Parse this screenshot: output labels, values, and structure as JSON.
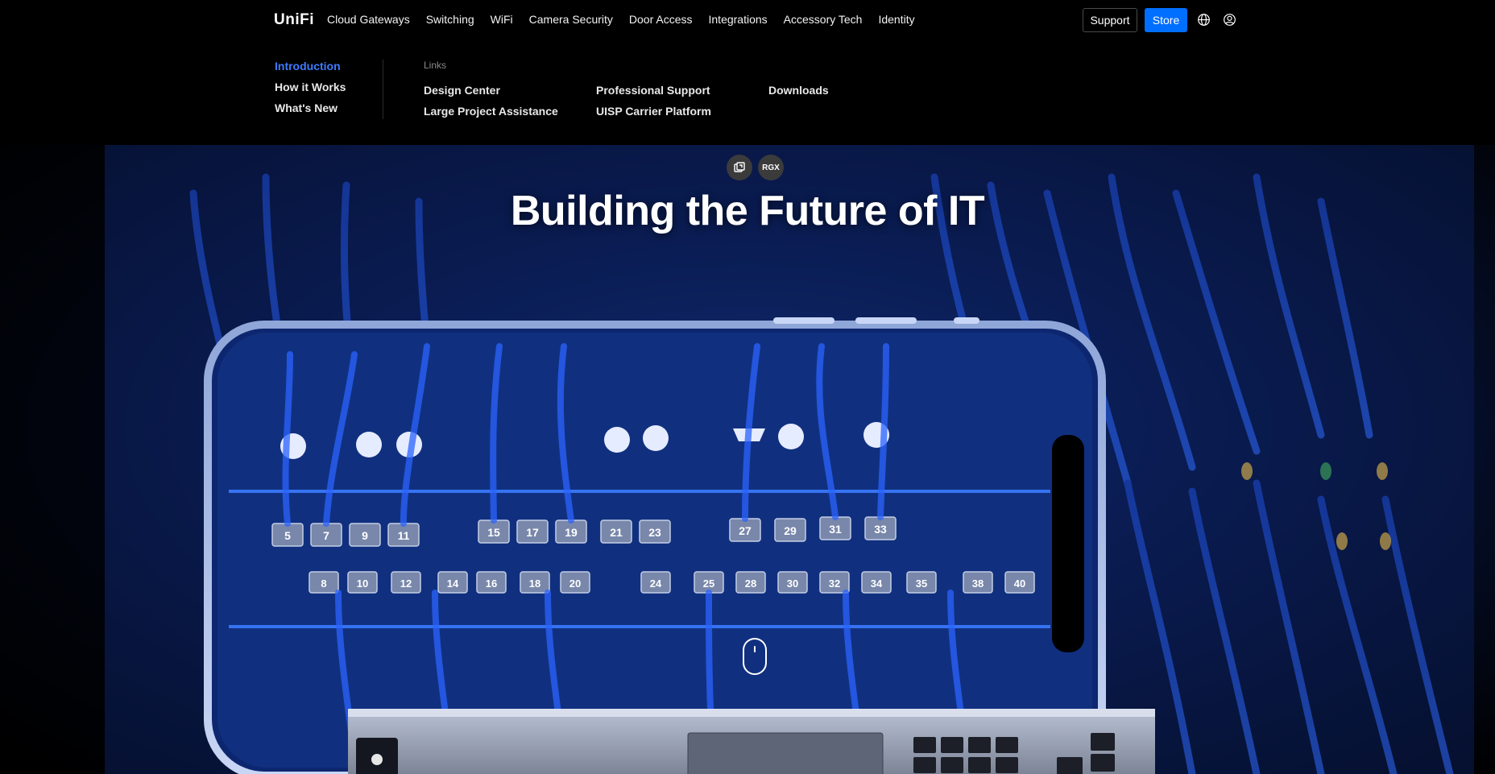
{
  "nav": {
    "logo": "UniFi",
    "items": [
      "Cloud Gateways",
      "Switching",
      "WiFi",
      "Camera Security",
      "Door Access",
      "Integrations",
      "Accessory Tech",
      "Identity"
    ],
    "support_label": "Support",
    "store_label": "Store"
  },
  "submenu": {
    "left_items": [
      "Introduction",
      "How it Works",
      "What's New"
    ],
    "links_heading": "Links",
    "links": [
      "Design Center",
      "Large Project Assistance",
      "Professional Support",
      "UISP Carrier Platform",
      "Downloads"
    ]
  },
  "hero": {
    "title": "Building the Future of IT",
    "tag_rgx": "RGX",
    "port_numbers_top": [
      "5",
      "7",
      "9",
      "11",
      "15",
      "17",
      "19",
      "21",
      "23",
      "27",
      "29",
      "31",
      "33"
    ],
    "port_numbers_bottom": [
      "8",
      "10",
      "12",
      "14",
      "16",
      "18",
      "20",
      "24",
      "25",
      "28",
      "30",
      "32",
      "34",
      "35",
      "38",
      "40"
    ]
  },
  "colors": {
    "accent_blue": "#006fff",
    "active_link": "#3d7bff",
    "background": "#000000"
  }
}
